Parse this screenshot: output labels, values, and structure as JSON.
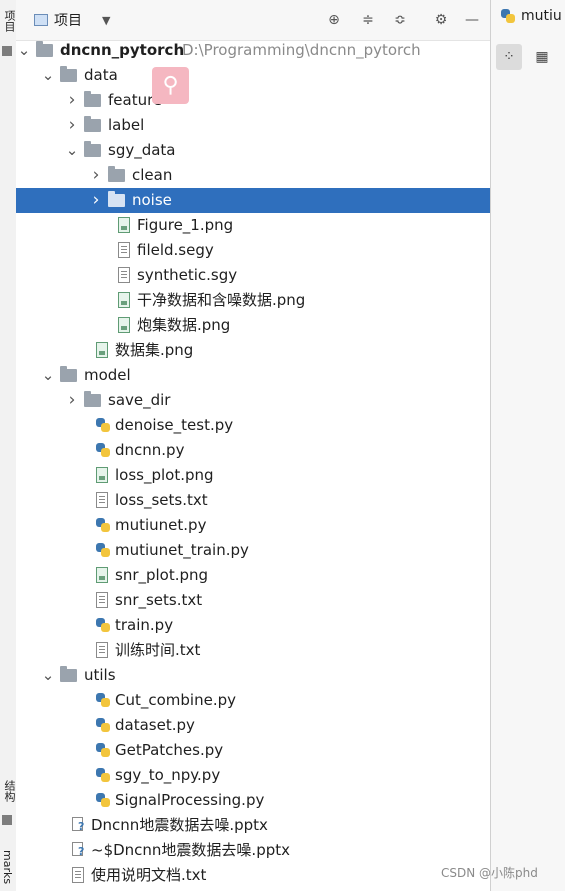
{
  "left_stripe": {
    "project_label": "项目",
    "structure_label": "结构",
    "bookmarks_label": "marks"
  },
  "toolbar": {
    "title": "项目",
    "dropdown_icon": "chevron-down-icon",
    "icons": [
      "locate-icon",
      "expand-all-icon",
      "collapse-all-icon",
      "gear-icon",
      "minimize-icon"
    ]
  },
  "tree": [
    {
      "label": "dncnn_pytorch",
      "path": "D:\\Programming\\dncnn_pytorch",
      "type": "folder",
      "depth": 0,
      "expanded": true,
      "root": true
    },
    {
      "label": "data",
      "type": "folder",
      "depth": 1,
      "expanded": true
    },
    {
      "label": "feature",
      "type": "folder",
      "depth": 2,
      "expanded": false
    },
    {
      "label": "label",
      "type": "folder",
      "depth": 2,
      "expanded": false
    },
    {
      "label": "sgy_data",
      "type": "folder",
      "depth": 2,
      "expanded": true
    },
    {
      "label": "clean",
      "type": "folder",
      "depth": 3,
      "expanded": false
    },
    {
      "label": "noise",
      "type": "folder",
      "depth": 3,
      "expanded": false,
      "selected": true
    },
    {
      "label": "Figure_1.png",
      "type": "img",
      "depth": 4
    },
    {
      "label": "fileld.segy",
      "type": "txt",
      "depth": 4
    },
    {
      "label": "synthetic.sgy",
      "type": "txt",
      "depth": 4
    },
    {
      "label": "干净数据和含噪数据.png",
      "type": "img",
      "depth": 4
    },
    {
      "label": "炮集数据.png",
      "type": "img",
      "depth": 4
    },
    {
      "label": "数据集.png",
      "type": "img",
      "depth": 3
    },
    {
      "label": "model",
      "type": "folder",
      "depth": 1,
      "expanded": true
    },
    {
      "label": "save_dir",
      "type": "folder",
      "depth": 2,
      "expanded": false
    },
    {
      "label": "denoise_test.py",
      "type": "py",
      "depth": 3
    },
    {
      "label": "dncnn.py",
      "type": "py",
      "depth": 3
    },
    {
      "label": "loss_plot.png",
      "type": "img",
      "depth": 3
    },
    {
      "label": "loss_sets.txt",
      "type": "txt",
      "depth": 3
    },
    {
      "label": "mutiunet.py",
      "type": "py",
      "depth": 3
    },
    {
      "label": "mutiunet_train.py",
      "type": "py",
      "depth": 3
    },
    {
      "label": "snr_plot.png",
      "type": "img",
      "depth": 3
    },
    {
      "label": "snr_sets.txt",
      "type": "txt",
      "depth": 3
    },
    {
      "label": "train.py",
      "type": "py",
      "depth": 3
    },
    {
      "label": "训练时间.txt",
      "type": "txt",
      "depth": 3
    },
    {
      "label": "utils",
      "type": "folder",
      "depth": 1,
      "expanded": true
    },
    {
      "label": "Cut_combine.py",
      "type": "py",
      "depth": 3
    },
    {
      "label": "dataset.py",
      "type": "py",
      "depth": 3
    },
    {
      "label": "GetPatches.py",
      "type": "py",
      "depth": 3
    },
    {
      "label": "sgy_to_npy.py",
      "type": "py",
      "depth": 3
    },
    {
      "label": "SignalProcessing.py",
      "type": "py",
      "depth": 3
    },
    {
      "label": "Dncnn地震数据去噪.pptx",
      "type": "ppt",
      "depth": 2
    },
    {
      "label": "~$Dncnn地震数据去噪.pptx",
      "type": "ppt",
      "depth": 2
    },
    {
      "label": "使用说明文档.txt",
      "type": "txt",
      "depth": 2
    }
  ],
  "right_panel": {
    "tab_label": "mutiu"
  },
  "watermark": "CSDN @小陈phd",
  "colors": {
    "selection": "#2f6fbd",
    "folder": "#9aa3ad",
    "python_blue": "#3d77b0",
    "python_yellow": "#f2c53d"
  }
}
